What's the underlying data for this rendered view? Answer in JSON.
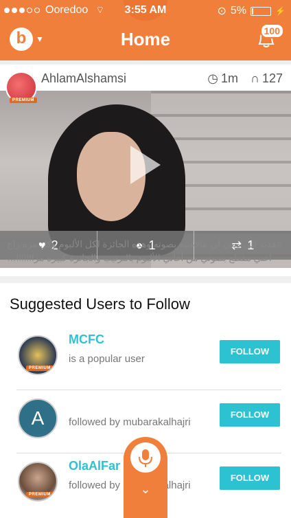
{
  "status_bar": {
    "carrier": "Ooredoo",
    "time": "3:55 AM",
    "battery": "5%"
  },
  "header": {
    "title": "Home",
    "notification_count": "100"
  },
  "post": {
    "username": "AhlamAlshamsi",
    "premium_badge": "PREMIUM",
    "time_ago": "1m",
    "listens": "127",
    "likes": "2",
    "comments": "1",
    "reposts": "1",
    "caption": "#هديه للي يغني لي هالاغنيه بصوته وهذه الجائزة لكل الألبوم وكل مره راح اغني مقطع بصوتي من أغاني الألبوم بالترتيب والجائزة كبيره مرا!!!!!!…"
  },
  "suggested": {
    "title": "Suggested Users to Follow",
    "users": [
      {
        "name": "MCFC",
        "description": "is a popular user",
        "premium": "PREMIUM",
        "follow_label": "FOLLOW"
      },
      {
        "initial": "A",
        "description": "followed by mubarakalhajri",
        "follow_label": "FOLLOW"
      },
      {
        "name": "OlaAlFar",
        "description": "followed by mubarakalhajri",
        "premium": "PREMIUM",
        "follow_label": "FOLLOW"
      }
    ]
  },
  "colors": {
    "brand": "#f07f3c",
    "accent": "#2dc2d1"
  }
}
